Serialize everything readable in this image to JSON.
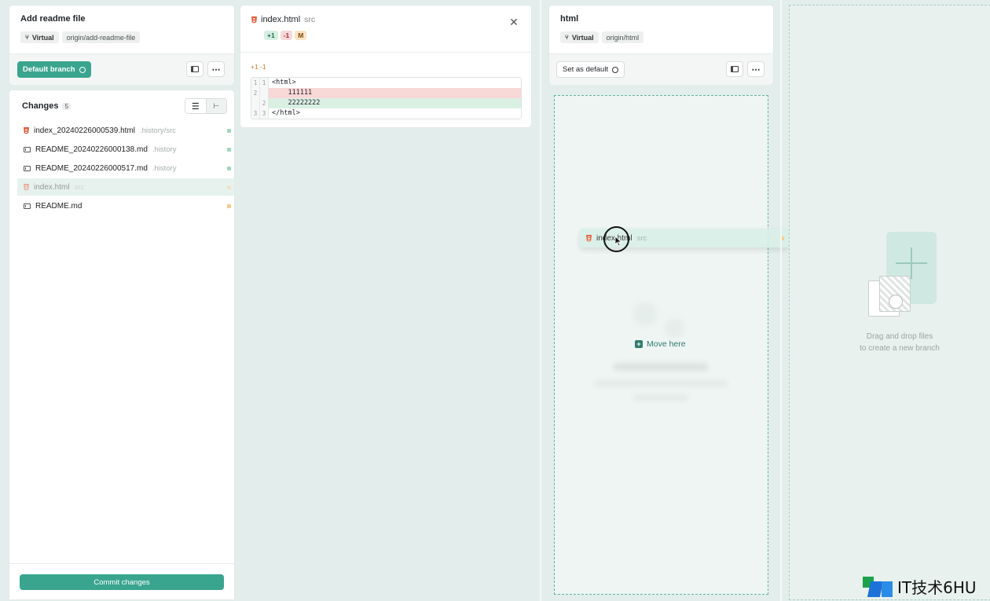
{
  "left": {
    "title": "Add readme file",
    "virtual_label": "Virtual",
    "remote": "origin/add-readme-file",
    "default_branch_label": "Default branch",
    "changes_label": "Changes",
    "changes_count": "5",
    "files": [
      {
        "name": "index_20240226000539.html",
        "path": ".history/src",
        "icon": "html-icon",
        "dot": "#9fd7c2"
      },
      {
        "name": "README_20240226000138.md",
        "path": ".history",
        "icon": "md-icon",
        "dot": "#9fd7c2"
      },
      {
        "name": "README_20240226000517.md",
        "path": ".history",
        "icon": "md-icon",
        "dot": "#9fd7c2"
      },
      {
        "name": "index.html",
        "path": "src",
        "icon": "html-icon",
        "dot": "#f1cf89"
      },
      {
        "name": "README.md",
        "path": "",
        "icon": "md-icon",
        "dot": "#f1cf89"
      }
    ],
    "commit_label": "Commit changes"
  },
  "diff": {
    "filename": "index.html",
    "path": "src",
    "badge_add": "+1",
    "badge_del": "-1",
    "badge_mod": "M",
    "hunk_header": "+1 -1",
    "lines": [
      {
        "old": "1",
        "new": "1",
        "code": "<html>",
        "type": "ctx"
      },
      {
        "old": "2",
        "new": "",
        "code": "    111111",
        "type": "del"
      },
      {
        "old": "",
        "new": "2",
        "code": "    22222222",
        "type": "add"
      },
      {
        "old": "3",
        "new": "3",
        "code": "</html>",
        "type": "ctx"
      }
    ]
  },
  "right": {
    "title": "html",
    "virtual_label": "Virtual",
    "remote": "origin/html",
    "set_default_label": "Set as default",
    "move_here_label": "Move here",
    "drag_file_name": "index.html",
    "drag_file_path": "src"
  },
  "new_branch": {
    "line1": "Drag and drop files",
    "line2": "to create a new branch"
  },
  "watermark": "IT技术6HU"
}
